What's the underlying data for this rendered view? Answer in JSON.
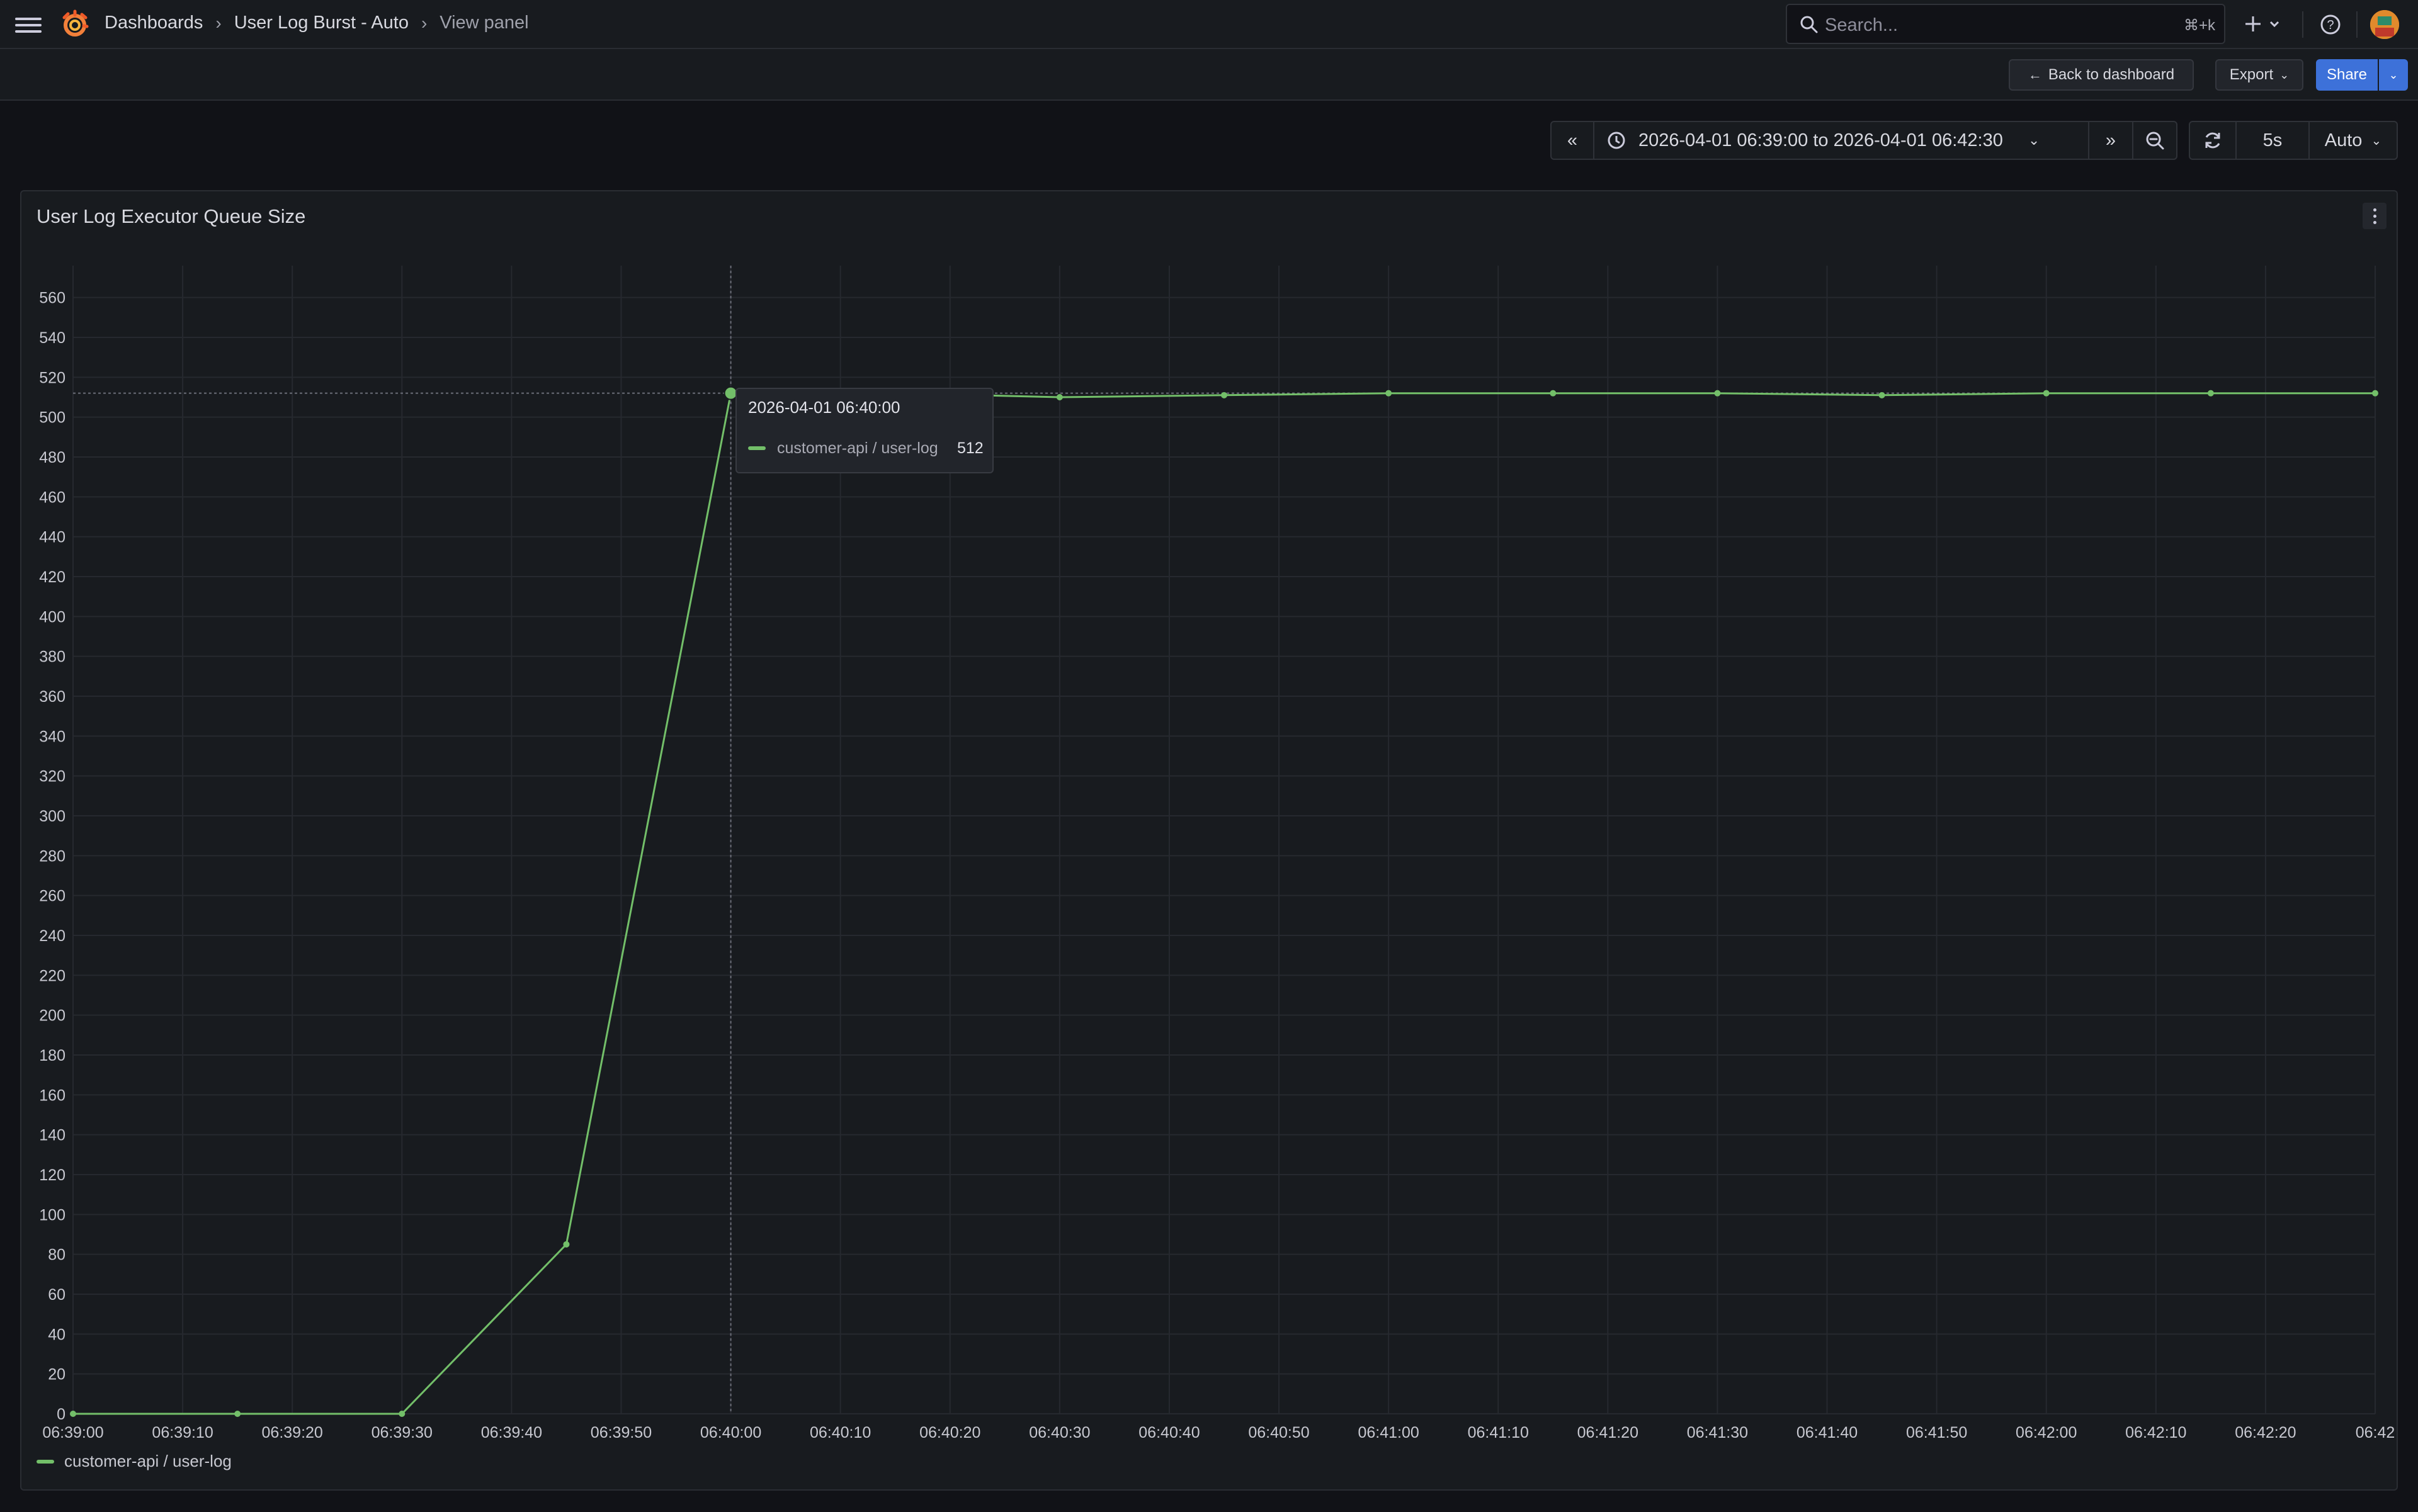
{
  "breadcrumbs": [
    "Dashboards",
    "User Log Burst - Auto",
    "View panel"
  ],
  "search": {
    "placeholder": "Search...",
    "shortcut": "⌘+k"
  },
  "toolbar": {
    "back_label": "Back to dashboard",
    "export_label": "Export",
    "share_label": "Share"
  },
  "time_controls": {
    "range": "2026-04-01 06:39:00 to 2026-04-01 06:42:30",
    "refresh_interval": "5s",
    "auto_label": "Auto"
  },
  "panel": {
    "title": "User Log Executor Queue Size"
  },
  "tooltip": {
    "time": "2026-04-01 06:40:00",
    "series": "customer-api / user-log",
    "value": "512"
  },
  "legend": {
    "series": "customer-api / user-log"
  },
  "colors": {
    "series": "#73bf69",
    "accent": "#3d71d9"
  },
  "icons": [
    "menu-icon",
    "grafana-logo",
    "search-icon",
    "plus-icon",
    "help-icon",
    "arrow-left-icon",
    "clock-icon",
    "zoom-out-icon",
    "refresh-icon"
  ],
  "chart_data": {
    "type": "line",
    "title": "User Log Executor Queue Size",
    "xlabel": "",
    "ylabel": "",
    "ylim": [
      0,
      560
    ],
    "y_ticks": [
      0,
      20,
      40,
      60,
      80,
      100,
      120,
      140,
      160,
      180,
      200,
      220,
      240,
      260,
      280,
      300,
      320,
      340,
      360,
      380,
      400,
      420,
      440,
      460,
      480,
      500,
      520,
      540,
      560
    ],
    "x_ticks": [
      "06:39:00",
      "06:39:10",
      "06:39:20",
      "06:39:30",
      "06:39:40",
      "06:39:50",
      "06:40:00",
      "06:40:10",
      "06:40:20",
      "06:40:30",
      "06:40:40",
      "06:40:50",
      "06:41:00",
      "06:41:10",
      "06:41:20",
      "06:41:30",
      "06:41:40",
      "06:41:50",
      "06:42:00",
      "06:42:10",
      "06:42:20",
      "06:42"
    ],
    "x_range": [
      "06:39:00",
      "06:42:30"
    ],
    "grid": true,
    "legend_position": "bottom-left",
    "series": [
      {
        "name": "customer-api / user-log",
        "color": "#73bf69",
        "points": [
          [
            "06:39:00",
            0
          ],
          [
            "06:39:15",
            0
          ],
          [
            "06:39:30",
            0
          ],
          [
            "06:39:45",
            85
          ],
          [
            "06:40:00",
            512
          ],
          [
            "06:40:15",
            512
          ],
          [
            "06:40:30",
            510
          ],
          [
            "06:40:45",
            511
          ],
          [
            "06:41:00",
            512
          ],
          [
            "06:41:15",
            512
          ],
          [
            "06:41:30",
            512
          ],
          [
            "06:41:45",
            511
          ],
          [
            "06:42:00",
            512
          ],
          [
            "06:42:15",
            512
          ],
          [
            "06:42:30",
            512
          ]
        ]
      }
    ],
    "hover_time": "06:40:00"
  }
}
